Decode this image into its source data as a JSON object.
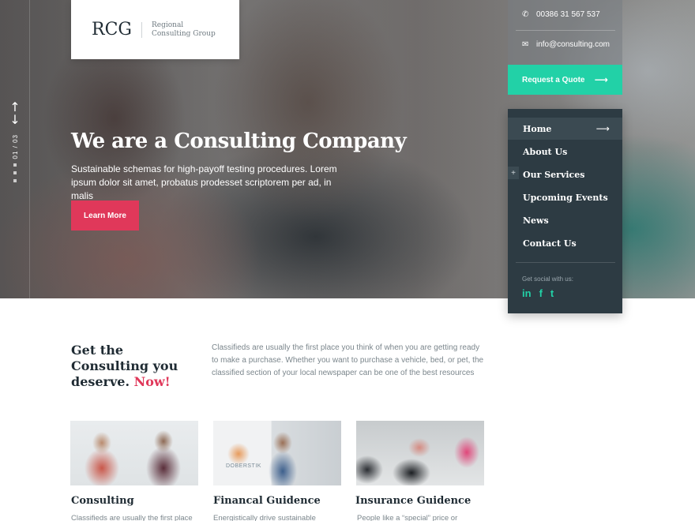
{
  "logo": {
    "mark": "RCG",
    "subtitle": "Regional Consulting Group"
  },
  "contact": {
    "phone": "00386 31 567 537",
    "email": "info@consulting.com"
  },
  "quote_button": {
    "label": "Request a Quote",
    "arrow": "⟶"
  },
  "slider": {
    "counter": "01 / 03",
    "up": "↑",
    "down": "↓"
  },
  "hero": {
    "title": "We are a Consulting Company",
    "text": "Sustainable schemas for high-payoff testing procedures. Lorem ipsum dolor sit amet, probatus prodesset scriptorem per ad, in malis",
    "button": "Learn More"
  },
  "nav": {
    "items": [
      {
        "label": "Home"
      },
      {
        "label": "About Us"
      },
      {
        "label": "Our Services"
      },
      {
        "label": "Upcoming Events"
      },
      {
        "label": "News"
      },
      {
        "label": "Contact Us"
      }
    ],
    "active_arrow": "⟶",
    "plus": "+",
    "social_label": "Get social with us:",
    "social": [
      "in",
      "f",
      "t"
    ]
  },
  "intro": {
    "title_main": "Get the Consulting you deserve.",
    "title_accent": "Now!",
    "text": "Classifieds are usually the first place you think of when you are getting ready to make a purchase. Whether you want to purchase a vehicle, bed, or pet, the classified section of your local newspaper can be one of the best resources"
  },
  "cards": [
    {
      "title": "Consulting",
      "text": "Classifieds are usually the first place"
    },
    {
      "title": "Financal Guidence",
      "text": "Energistically drive sustainable",
      "image_label": "DOBERSTIK"
    },
    {
      "title": "Insurance Guidence",
      "text": "People like a “special” price or"
    }
  ],
  "colors": {
    "accent": "#e0385a",
    "teal": "#22d1a7",
    "nav_bg": "#2d3b43",
    "heading": "#1f2b33"
  }
}
